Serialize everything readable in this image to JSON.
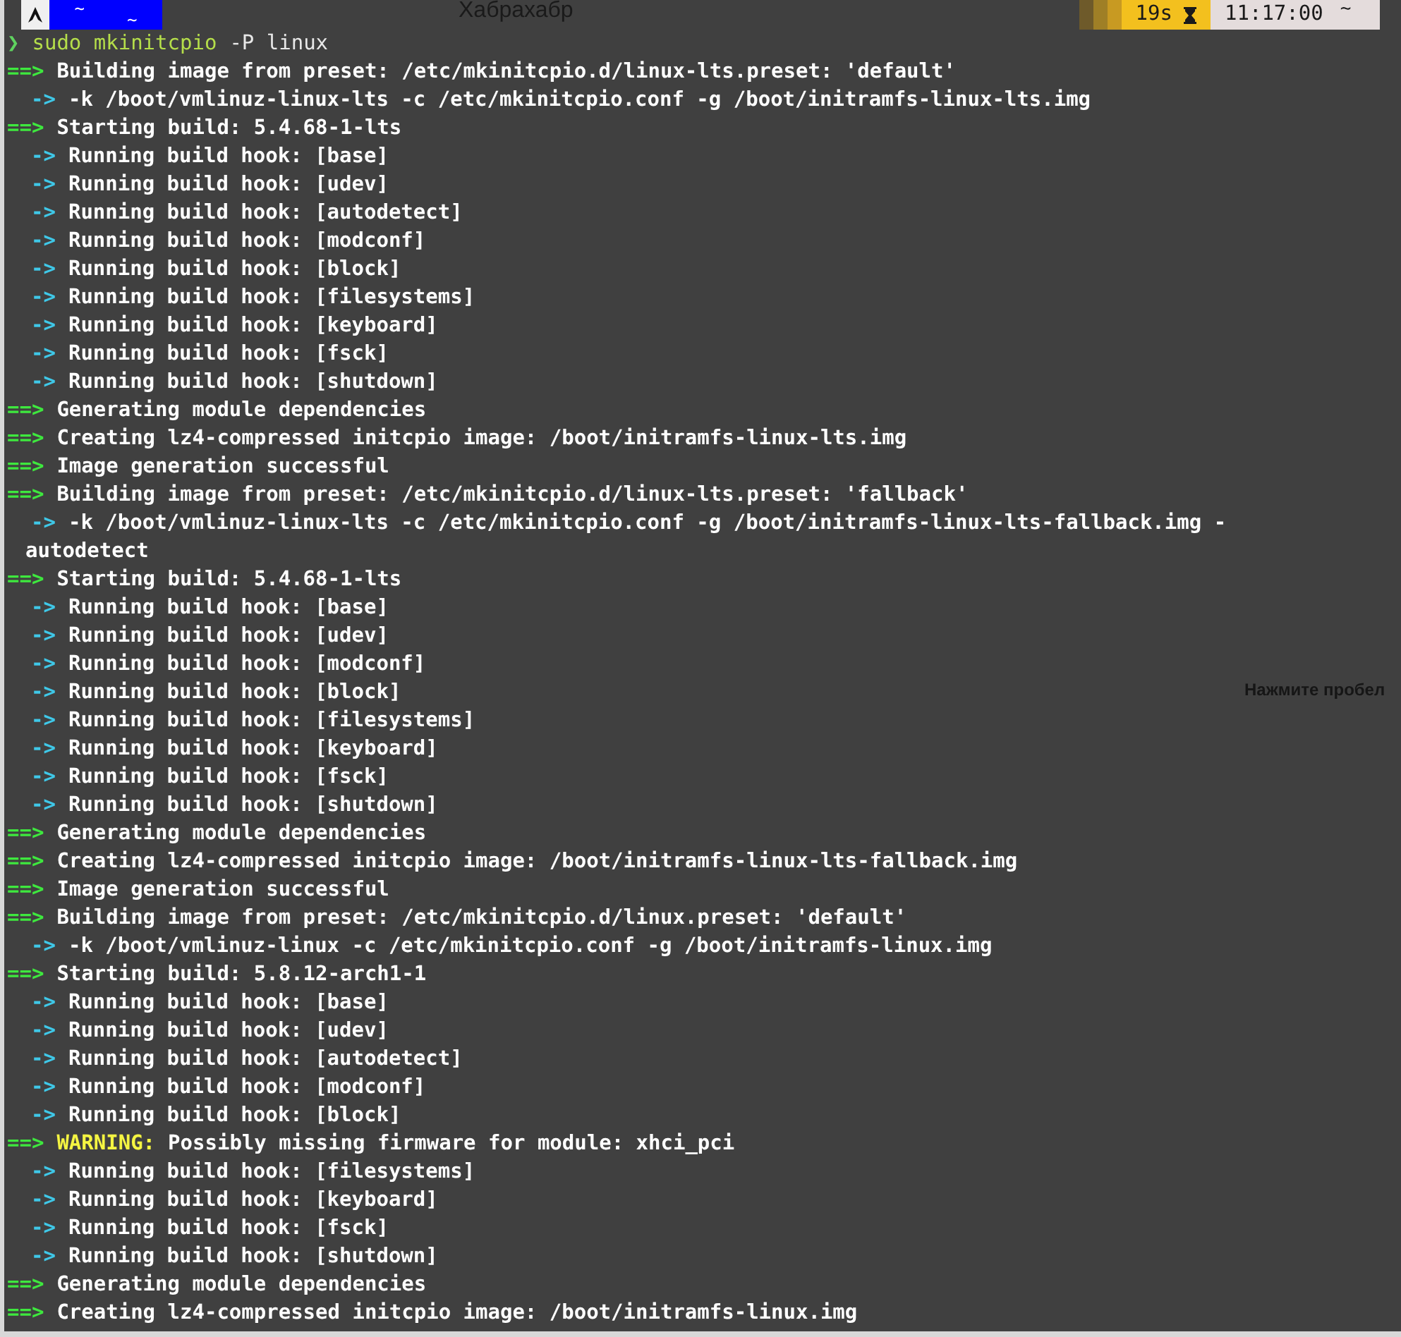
{
  "background_texts": [
    {
      "kind": "tab",
      "text": "Хабрахабр"
    },
    {
      "kind": "hint",
      "text": "Нажмите пробел"
    }
  ],
  "prompt_bar": {
    "left_segments": [
      "~",
      "~"
    ],
    "duration": "19s",
    "time": "11:17:00",
    "tilde": "~"
  },
  "command": {
    "prompt": "❯",
    "program": "sudo mkinitcpio",
    "args": "-P linux"
  },
  "lines": [
    {
      "kind": "section",
      "marker": "==>",
      "text": "Building image from preset: /etc/mkinitcpio.d/linux-lts.preset: 'default'"
    },
    {
      "kind": "step",
      "marker": "->",
      "text": "-k /boot/vmlinuz-linux-lts -c /etc/mkinitcpio.conf -g /boot/initramfs-linux-lts.img"
    },
    {
      "kind": "section",
      "marker": "==>",
      "text": "Starting build: 5.4.68-1-lts"
    },
    {
      "kind": "step",
      "marker": "->",
      "text": "Running build hook: [base]"
    },
    {
      "kind": "step",
      "marker": "->",
      "text": "Running build hook: [udev]"
    },
    {
      "kind": "step",
      "marker": "->",
      "text": "Running build hook: [autodetect]"
    },
    {
      "kind": "step",
      "marker": "->",
      "text": "Running build hook: [modconf]"
    },
    {
      "kind": "step",
      "marker": "->",
      "text": "Running build hook: [block]"
    },
    {
      "kind": "step",
      "marker": "->",
      "text": "Running build hook: [filesystems]"
    },
    {
      "kind": "step",
      "marker": "->",
      "text": "Running build hook: [keyboard]"
    },
    {
      "kind": "step",
      "marker": "->",
      "text": "Running build hook: [fsck]"
    },
    {
      "kind": "step",
      "marker": "->",
      "text": "Running build hook: [shutdown]"
    },
    {
      "kind": "section",
      "marker": "==>",
      "text": "Generating module dependencies"
    },
    {
      "kind": "section",
      "marker": "==>",
      "text": "Creating lz4-compressed initcpio image: /boot/initramfs-linux-lts.img"
    },
    {
      "kind": "section",
      "marker": "==>",
      "text": "Image generation successful"
    },
    {
      "kind": "section",
      "marker": "==>",
      "text": "Building image from preset: /etc/mkinitcpio.d/linux-lts.preset: 'fallback'"
    },
    {
      "kind": "step",
      "marker": "->",
      "text": "-k /boot/vmlinuz-linux-lts -c /etc/mkinitcpio.conf -g /boot/initramfs-linux-lts-fallback.img -"
    },
    {
      "kind": "continuation",
      "text": "autodetect"
    },
    {
      "kind": "section",
      "marker": "==>",
      "text": "Starting build: 5.4.68-1-lts"
    },
    {
      "kind": "step",
      "marker": "->",
      "text": "Running build hook: [base]"
    },
    {
      "kind": "step",
      "marker": "->",
      "text": "Running build hook: [udev]"
    },
    {
      "kind": "step",
      "marker": "->",
      "text": "Running build hook: [modconf]"
    },
    {
      "kind": "step",
      "marker": "->",
      "text": "Running build hook: [block]"
    },
    {
      "kind": "step",
      "marker": "->",
      "text": "Running build hook: [filesystems]"
    },
    {
      "kind": "step",
      "marker": "->",
      "text": "Running build hook: [keyboard]"
    },
    {
      "kind": "step",
      "marker": "->",
      "text": "Running build hook: [fsck]"
    },
    {
      "kind": "step",
      "marker": "->",
      "text": "Running build hook: [shutdown]"
    },
    {
      "kind": "section",
      "marker": "==>",
      "text": "Generating module dependencies"
    },
    {
      "kind": "section",
      "marker": "==>",
      "text": "Creating lz4-compressed initcpio image: /boot/initramfs-linux-lts-fallback.img"
    },
    {
      "kind": "section",
      "marker": "==>",
      "text": "Image generation successful"
    },
    {
      "kind": "section",
      "marker": "==>",
      "text": "Building image from preset: /etc/mkinitcpio.d/linux.preset: 'default'"
    },
    {
      "kind": "step",
      "marker": "->",
      "text": "-k /boot/vmlinuz-linux -c /etc/mkinitcpio.conf -g /boot/initramfs-linux.img"
    },
    {
      "kind": "section",
      "marker": "==>",
      "text": "Starting build: 5.8.12-arch1-1"
    },
    {
      "kind": "step",
      "marker": "->",
      "text": "Running build hook: [base]"
    },
    {
      "kind": "step",
      "marker": "->",
      "text": "Running build hook: [udev]"
    },
    {
      "kind": "step",
      "marker": "->",
      "text": "Running build hook: [autodetect]"
    },
    {
      "kind": "step",
      "marker": "->",
      "text": "Running build hook: [modconf]"
    },
    {
      "kind": "step",
      "marker": "->",
      "text": "Running build hook: [block]"
    },
    {
      "kind": "warning",
      "marker": "==>",
      "label": "WARNING:",
      "text": "Possibly missing firmware for module: xhci_pci"
    },
    {
      "kind": "step",
      "marker": "->",
      "text": "Running build hook: [filesystems]"
    },
    {
      "kind": "step",
      "marker": "->",
      "text": "Running build hook: [keyboard]"
    },
    {
      "kind": "step",
      "marker": "->",
      "text": "Running build hook: [fsck]"
    },
    {
      "kind": "step",
      "marker": "->",
      "text": "Running build hook: [shutdown]"
    },
    {
      "kind": "section",
      "marker": "==>",
      "text": "Generating module dependencies"
    },
    {
      "kind": "section",
      "marker": "==>",
      "text": "Creating lz4-compressed initcpio image: /boot/initramfs-linux.img"
    }
  ]
}
